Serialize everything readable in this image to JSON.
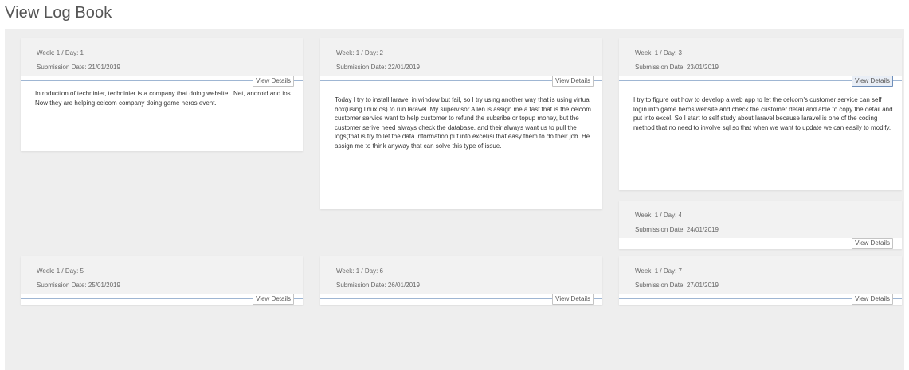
{
  "page": {
    "title": "View Log Book"
  },
  "labels": {
    "view_details": "View Details"
  },
  "entries": [
    {
      "week_day": "Week: 1 / Day: 1",
      "submission": "Submission Date: 21/01/2019",
      "body": "Introduction of techninier, techninier is a company that doing website, .Net, android and ios. Now they are helping celcom company doing game heros event."
    },
    {
      "week_day": "Week: 1 / Day: 2",
      "submission": "Submission Date: 22/01/2019",
      "body": "Today I try to install laravel in window but fail, so I try using another way that is using virtual box(using linux os) to run laravel. My supervisor Allen is assign me a tast that is the celcom customer service want to help customer to refund the subsribe or topup money, but the customer serive need always check the database, and their always want us to pull the logs(that is try to let the data information put into excel)si that easy them to do their job. He assign me to think anyway that can solve this type of issue."
    },
    {
      "week_day": "Week: 1 / Day: 3",
      "submission": "Submission Date: 23/01/2019",
      "body": "I try to figure out how to develop a web app to let the celcom's customer service can self login into game heros website and check the customer detail and able to copy the detail and put into excel. So I start to self study about laravel because laravel is one of the coding method that no need to involve sql so that when we want to update we can easily to modify."
    },
    {
      "week_day": "Week: 1 / Day: 4",
      "submission": "Submission Date: 24/01/2019",
      "body": ""
    },
    {
      "week_day": "Week: 1 / Day: 5",
      "submission": "Submission Date: 25/01/2019",
      "body": ""
    },
    {
      "week_day": "Week: 1 / Day: 6",
      "submission": "Submission Date: 26/01/2019",
      "body": ""
    },
    {
      "week_day": "Week: 1 / Day: 7",
      "submission": "Submission Date: 27/01/2019",
      "body": ""
    }
  ]
}
